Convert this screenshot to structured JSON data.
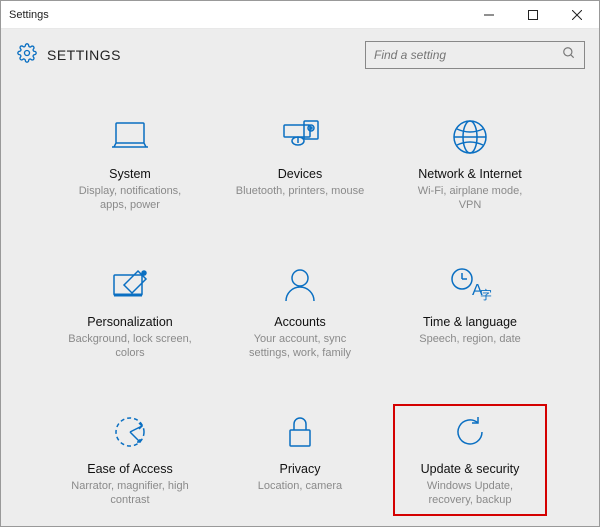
{
  "titlebar": {
    "title": "Settings"
  },
  "header": {
    "title": "SETTINGS"
  },
  "search": {
    "placeholder": "Find a setting"
  },
  "tiles": {
    "system": {
      "title": "System",
      "sub": "Display, notifications, apps, power"
    },
    "devices": {
      "title": "Devices",
      "sub": "Bluetooth, printers, mouse"
    },
    "network": {
      "title": "Network & Internet",
      "sub": "Wi-Fi, airplane mode, VPN"
    },
    "personal": {
      "title": "Personalization",
      "sub": "Background, lock screen, colors"
    },
    "accounts": {
      "title": "Accounts",
      "sub": "Your account, sync settings, work, family"
    },
    "timelang": {
      "title": "Time & language",
      "sub": "Speech, region, date"
    },
    "ease": {
      "title": "Ease of Access",
      "sub": "Narrator, magnifier, high contrast"
    },
    "privacy": {
      "title": "Privacy",
      "sub": "Location, camera"
    },
    "update": {
      "title": "Update & security",
      "sub": "Windows Update, recovery, backup"
    }
  },
  "colors": {
    "accent": "#0a6fc2",
    "highlight": "#d40000"
  }
}
